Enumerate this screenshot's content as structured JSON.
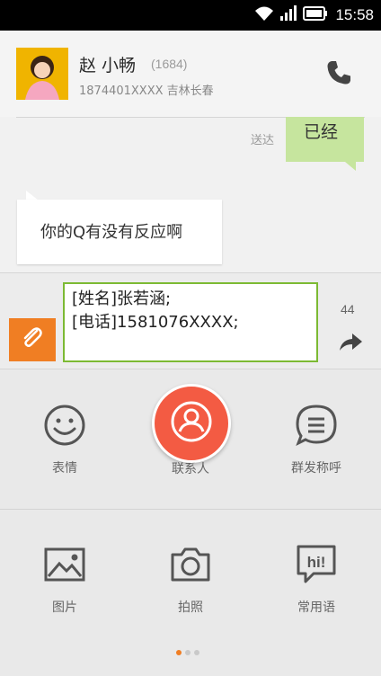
{
  "status_bar": {
    "time": "15:58"
  },
  "header": {
    "name": "赵 小畅",
    "count": "(1684)",
    "phone_location": "1874401XXXX  吉林长春",
    "call_icon": "phone-icon"
  },
  "chat": {
    "sent_status": "送达",
    "outgoing_text": "已经",
    "incoming_text": "你的Q有没有反应啊"
  },
  "compose": {
    "message": "[姓名]张若涵;\n[电话]1581076XXXX;",
    "char_count": "44",
    "attach_icon": "paperclip-icon",
    "send_icon": "send-arrow-icon"
  },
  "panel": {
    "row1": [
      {
        "label": "表情",
        "icon": "smiley-icon"
      },
      {
        "label": "联系人",
        "icon": "contact-icon"
      },
      {
        "label": "群发称呼",
        "icon": "group-message-icon"
      }
    ],
    "row2": [
      {
        "label": "图片",
        "icon": "image-icon"
      },
      {
        "label": "拍照",
        "icon": "camera-icon"
      },
      {
        "label": "常用语",
        "icon": "hi-bubble-icon"
      }
    ],
    "pages": {
      "count": 3,
      "active": 1
    }
  },
  "colors": {
    "accent_orange": "#f07e23",
    "contact_red": "#f35b43",
    "bubble_green": "#c6e59e",
    "input_border": "#7cba33"
  }
}
